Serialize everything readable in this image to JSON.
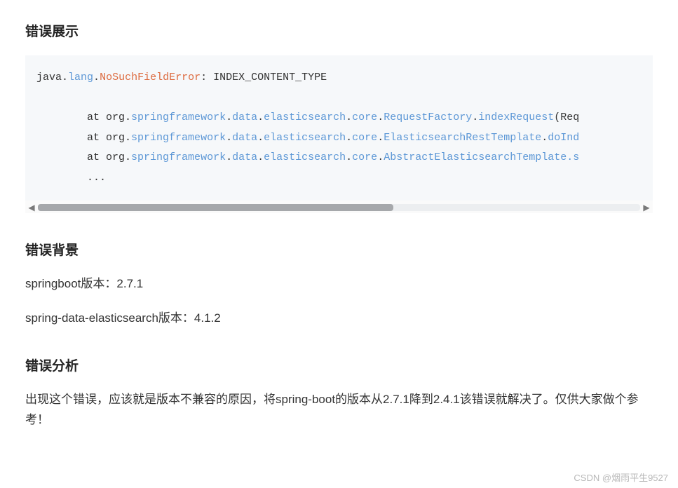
{
  "sections": {
    "error_display_heading": "错误展示",
    "error_background_heading": "错误背景",
    "error_analysis_heading": "错误分析"
  },
  "code": {
    "line1_prefix": "java",
    "line1_dot1": ".",
    "line1_pkg": "lang",
    "line1_dot2": ".",
    "line1_err": "NoSuchFieldError",
    "line1_suffix": ": INDEX_CONTENT_TYPE",
    "indent": "        ",
    "at_org": "at org",
    "dot": ".",
    "spring_pkg": "springframework",
    "data_pkg": "data",
    "es_pkg": "elasticsearch",
    "core_pkg": "core",
    "reqfactory": "RequestFactory",
    "indexrequest": "indexRequest",
    "open_req": "(Req",
    "esresttmpl": "ElasticsearchRestTemplate",
    "doind": "doInd",
    "abstmpl": "AbstractElasticsearchTemplate",
    "dot_s": ".s",
    "ellipsis": "..."
  },
  "background": {
    "line1": "springboot版本：2.7.1",
    "line2": "spring-data-elasticsearch版本：4.1.2"
  },
  "analysis": {
    "para": "出现这个错误，应该就是版本不兼容的原因，将spring-boot的版本从2.7.1降到2.4.1该错误就解决了。仅供大家做个参考！"
  },
  "scroll": {
    "left_arrow": "◀",
    "right_arrow": "▶"
  },
  "watermark": "CSDN @烟雨平生9527"
}
